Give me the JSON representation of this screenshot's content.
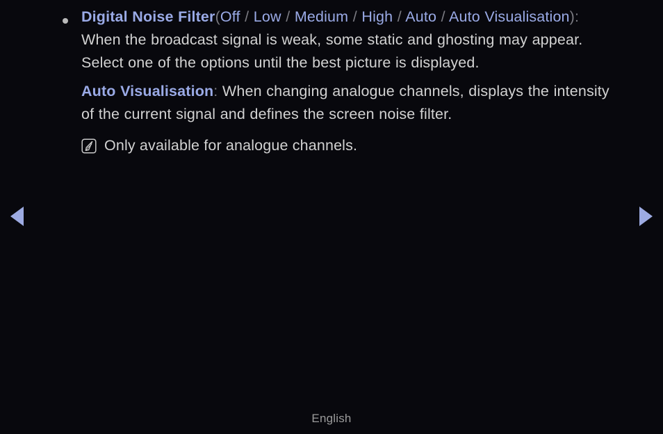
{
  "page": {
    "background_color": "#08080d",
    "body_text_color": "#d2d2d2",
    "keyword_color": "#9aaae6",
    "punctuation_color": "#7b7b82",
    "arrow_color": "#9dabe2"
  },
  "content": {
    "bullet": {
      "title_keyword": "Digital Noise Filter",
      "open_paren": "(",
      "options": [
        "Off",
        "Low",
        "Medium",
        "High",
        "Auto",
        "Auto Visualisation"
      ],
      "separator": "/",
      "close_paren": "):",
      "description": "When the broadcast signal is weak, some static and ghosting may appear. Select one of the options until the best picture is displayed."
    },
    "definition": {
      "term": "Auto Visualisation",
      "colon": ":",
      "text": " When changing analogue channels, displays the intensity of the current signal and defines the screen noise filter."
    },
    "note": {
      "icon": "note-memo-icon",
      "text": "Only available for analogue channels."
    }
  },
  "navigation": {
    "prev_icon": "triangle-left-icon",
    "next_icon": "triangle-right-icon"
  },
  "footer": {
    "language": "English"
  }
}
